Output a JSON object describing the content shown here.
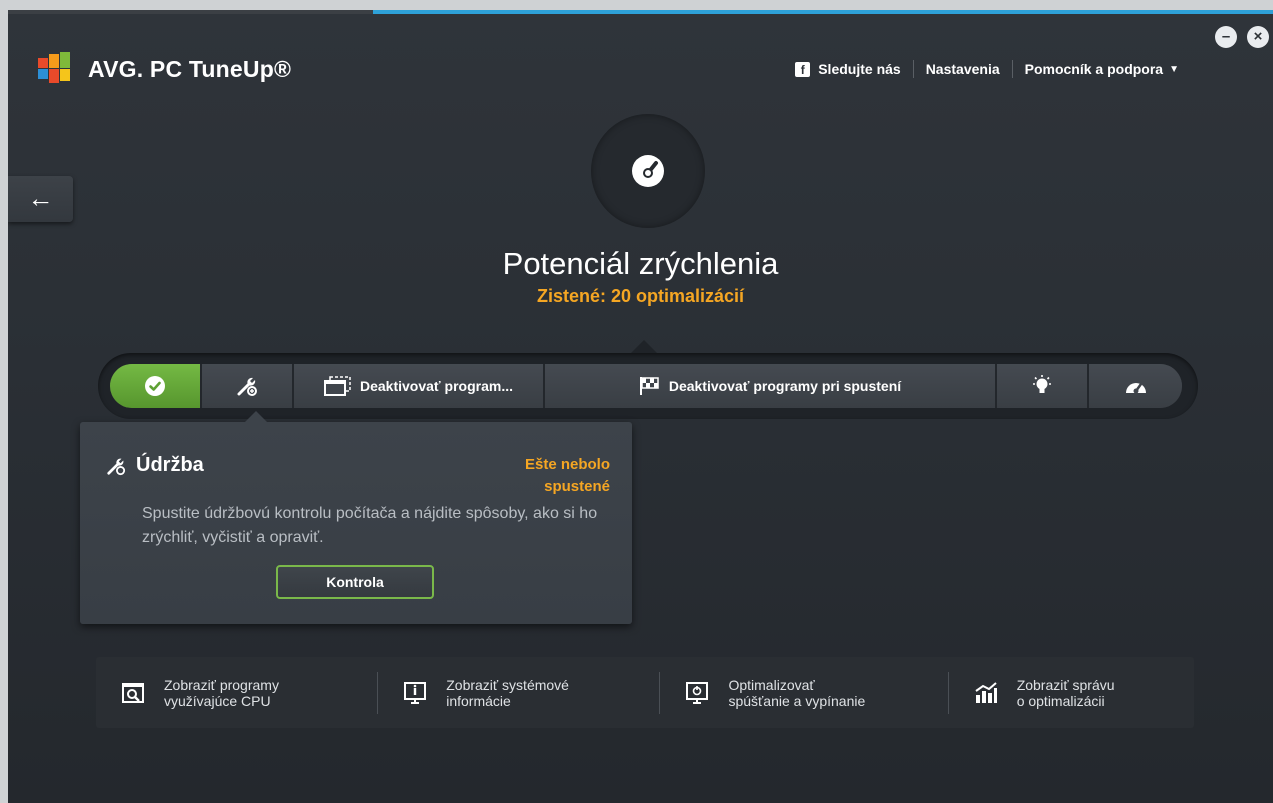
{
  "brand": {
    "name": "AVG. PC TuneUp®"
  },
  "topnav": {
    "follow": "Sledujte nás",
    "settings": "Nastavenia",
    "help": "Pomocník a podpora"
  },
  "window": {
    "minimize": "–",
    "close": "×"
  },
  "back": {
    "label": "←"
  },
  "hero": {
    "title": "Potenciál zrýchlenia",
    "subtitle": "Zistené: 20 optimalizácií"
  },
  "toolbar": {
    "items": [
      {
        "label": "",
        "icon": "check-icon"
      },
      {
        "label": "",
        "icon": "wrench-icon"
      },
      {
        "label": "Deaktivovať program...",
        "icon": "windows-icon"
      },
      {
        "label": "Deaktivovať programy pri spustení",
        "icon": "flag-icon"
      },
      {
        "label": "",
        "icon": "lightbulb-icon"
      },
      {
        "label": "",
        "icon": "speedometer-icon"
      }
    ]
  },
  "panel": {
    "title": "Údržba",
    "status": "Ešte nebolo spustené",
    "description": "Spustite údržbovú kontrolu počítača a nájdite spôsoby, ako si ho zrýchliť, vyčistiť a opraviť.",
    "button": "Kontrola"
  },
  "bottom": {
    "items": [
      {
        "line1": "Zobraziť programy",
        "line2": "využívajúce CPU",
        "icon": "cpu-search-icon"
      },
      {
        "line1": "Zobraziť systémové",
        "line2": "informácie",
        "icon": "system-info-icon"
      },
      {
        "line1": "Optimalizovať",
        "line2": "spúšťanie a vypínanie",
        "icon": "startup-monitor-icon"
      },
      {
        "line1": "Zobraziť správu",
        "line2": "o optimalizácii",
        "icon": "report-chart-icon"
      }
    ]
  },
  "colors": {
    "accent_orange": "#f5a623",
    "accent_green": "#6aae3d",
    "top_line_blue": "#2ea1d8",
    "background": "#2b3035"
  }
}
